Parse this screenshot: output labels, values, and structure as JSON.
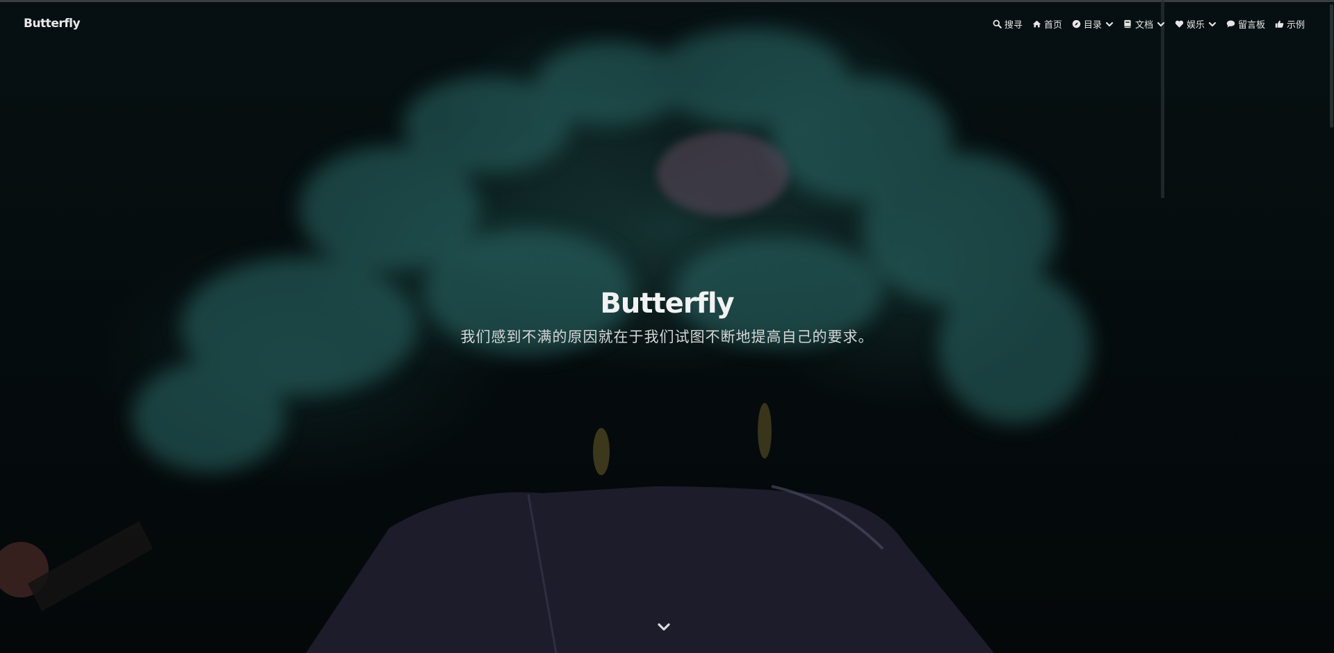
{
  "brand": "Butterfly",
  "nav": {
    "items": [
      {
        "label": "搜寻",
        "icon": "search-icon",
        "dropdown": false
      },
      {
        "label": "首页",
        "icon": "home-icon",
        "dropdown": false
      },
      {
        "label": "目录",
        "icon": "compass-icon",
        "dropdown": true
      },
      {
        "label": "文档",
        "icon": "book-icon",
        "dropdown": true
      },
      {
        "label": "娱乐",
        "icon": "heart-icon",
        "dropdown": true
      },
      {
        "label": "留言板",
        "icon": "comment-icon",
        "dropdown": false
      },
      {
        "label": "示例",
        "icon": "thumbs-up-icon",
        "dropdown": false
      }
    ]
  },
  "hero": {
    "title": "Butterfly",
    "subtitle": "我们感到不满的原因就在于我们试图不断地提高自己的要求。"
  },
  "colors": {
    "smoke": "#2a6664",
    "background": "#05090b",
    "text": "#e6e6e6"
  }
}
